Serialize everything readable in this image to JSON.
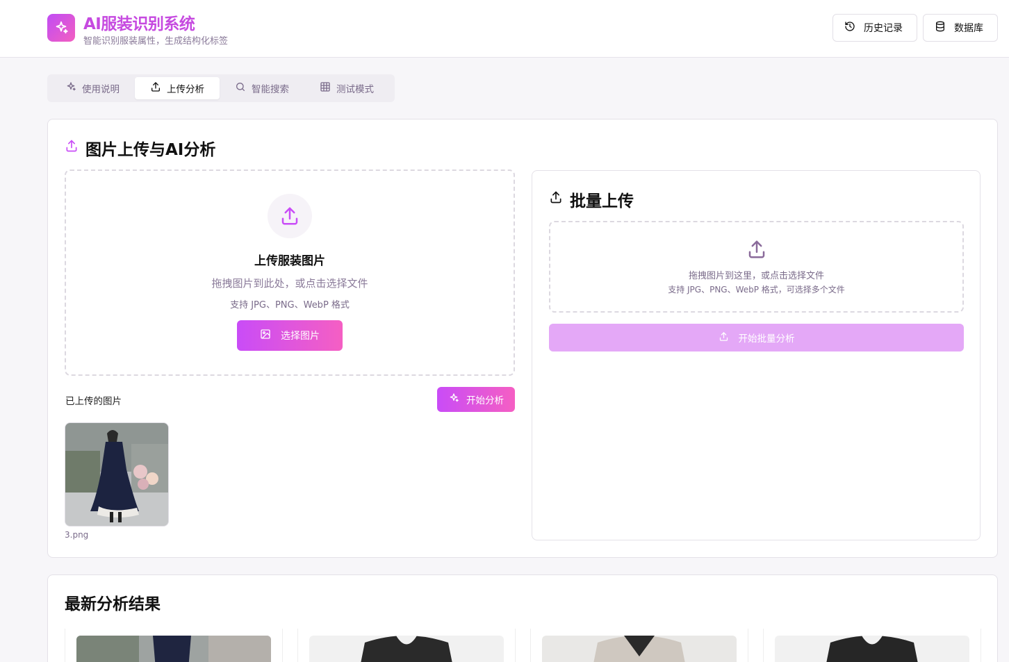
{
  "header": {
    "title": "AI服装识别系统",
    "subtitle": "智能识别服装属性，生成结构化标签",
    "history_label": "历史记录",
    "database_label": "数据库"
  },
  "tabs": [
    {
      "label": "使用说明",
      "icon": "sparkles-icon"
    },
    {
      "label": "上传分析",
      "icon": "upload-icon",
      "active": true
    },
    {
      "label": "智能搜索",
      "icon": "search-icon"
    },
    {
      "label": "测试模式",
      "icon": "grid-icon"
    }
  ],
  "upload": {
    "section_title": "图片上传与AI分析",
    "heading": "上传服装图片",
    "hint": "拖拽图片到此处，或点击选择文件",
    "formats": "支持 JPG、PNG、WebP 格式",
    "select_label": "选择图片",
    "uploaded_label": "已上传的图片",
    "analyze_label": "开始分析",
    "files": [
      {
        "name": "3.png"
      }
    ]
  },
  "batch": {
    "title": "批量上传",
    "hint": "拖拽图片到这里，或点击选择文件",
    "formats": "支持 JPG、PNG、WebP 格式，可选择多个文件",
    "button_label": "开始批量分析"
  },
  "results": {
    "title": "最新分析结果"
  },
  "colors": {
    "accent_start": "#c94cf7",
    "accent_end": "#f55fc3",
    "muted_text": "#8a7a99"
  }
}
